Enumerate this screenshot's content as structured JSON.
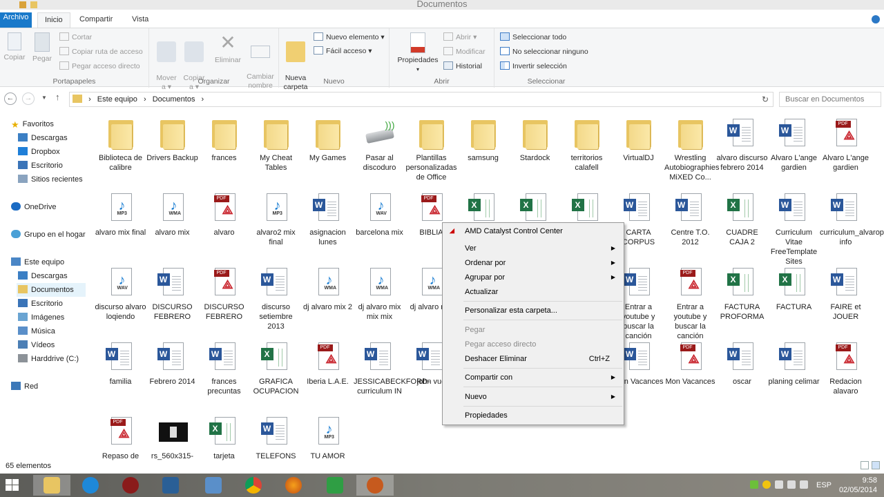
{
  "window": {
    "title": "Documentos"
  },
  "tabs": {
    "file": "Archivo",
    "home": "Inicio",
    "share": "Compartir",
    "view": "Vista"
  },
  "ribbon": {
    "clipboard": {
      "label": "Portapapeles",
      "copy": "Copiar",
      "paste": "Pegar",
      "cut": "Cortar",
      "copy_path": "Copiar ruta de acceso",
      "paste_shortcut": "Pegar acceso directo"
    },
    "organize": {
      "label": "Organizar",
      "move": "Mover\na ▾",
      "copy_to": "Copiar\na ▾",
      "delete": "Eliminar",
      "rename": "Cambiar\nnombre"
    },
    "new": {
      "label": "Nuevo",
      "new_folder": "Nueva\ncarpeta",
      "new_item": "Nuevo elemento ▾",
      "easy_access": "Fácil acceso ▾"
    },
    "open": {
      "label": "Abrir",
      "properties": "Propiedades",
      "open": "Abrir ▾",
      "edit": "Modificar",
      "history": "Historial"
    },
    "select": {
      "label": "Seleccionar",
      "select_all": "Seleccionar todo",
      "select_none": "No seleccionar ninguno",
      "invert": "Invertir selección"
    }
  },
  "address": {
    "crumbs": [
      "Este equipo",
      "›",
      "Documentos",
      "›"
    ],
    "search_placeholder": "Buscar en Documentos"
  },
  "navpane": {
    "favorites": "Favoritos",
    "downloads": "Descargas",
    "dropbox": "Dropbox",
    "desktop": "Escritorio",
    "recent": "Sitios recientes",
    "onedrive": "OneDrive",
    "homegroup": "Grupo en el hogar",
    "thispc": "Este equipo",
    "pc_downloads": "Descargas",
    "pc_documents": "Documentos",
    "pc_desktop": "Escritorio",
    "pc_images": "Imágenes",
    "pc_music": "Música",
    "pc_videos": "Vídeos",
    "pc_drive": "Harddrive (C:)",
    "network": "Red"
  },
  "files": [
    {
      "name": "Biblioteca de calibre",
      "type": "folder"
    },
    {
      "name": "Drivers Backup",
      "type": "folder"
    },
    {
      "name": "frances",
      "type": "folder"
    },
    {
      "name": "My Cheat Tables",
      "type": "folder"
    },
    {
      "name": "My Games",
      "type": "folder"
    },
    {
      "name": "Pasar al discoduro",
      "type": "drive"
    },
    {
      "name": "Plantillas personalizadas de Office",
      "type": "folder"
    },
    {
      "name": "samsung",
      "type": "folder"
    },
    {
      "name": "Stardock",
      "type": "folder"
    },
    {
      "name": "territorios calafell",
      "type": "folder"
    },
    {
      "name": "VirtualDJ",
      "type": "folder"
    },
    {
      "name": "Wrestling Autobiographies MiXED Co...",
      "type": "folder"
    },
    {
      "name": "alvaro discurso febrero 2014",
      "type": "word"
    },
    {
      "name": "Alvaro L'ange gardien",
      "type": "word"
    },
    {
      "name": "Alvaro L'ange gardien",
      "type": "pdf"
    },
    {
      "name": "alvaro mix final",
      "type": "mp3"
    },
    {
      "name": "alvaro mix",
      "type": "wma"
    },
    {
      "name": "alvaro",
      "type": "pdf"
    },
    {
      "name": "alvaro2 mix final",
      "type": "mp3"
    },
    {
      "name": "asignacion lunes",
      "type": "word"
    },
    {
      "name": "barcelona mix",
      "type": "wav"
    },
    {
      "name": "BIBLIA",
      "type": "pdf"
    },
    {
      "name": "",
      "type": "excel"
    },
    {
      "name": "",
      "type": "excel"
    },
    {
      "name": "",
      "type": "excel"
    },
    {
      "name": "CARTA CORPUS",
      "type": "word"
    },
    {
      "name": "Centre T.O. 2012",
      "type": "word"
    },
    {
      "name": "CUADRE CAJA 2",
      "type": "excel"
    },
    {
      "name": "Curriculum Vitae FreeTemplate Sites",
      "type": "word"
    },
    {
      "name": "curriculum_alvaropaez_B-info",
      "type": "word"
    },
    {
      "name": "discurso alvaro loqiendo",
      "type": "wav"
    },
    {
      "name": "DISCURSO FEBRERO",
      "type": "word"
    },
    {
      "name": "DISCURSO FEBRERO",
      "type": "pdf"
    },
    {
      "name": "discurso setiembre 2013",
      "type": "word"
    },
    {
      "name": "dj alvaro mix 2",
      "type": "wma"
    },
    {
      "name": "dj alvaro mix mix mix",
      "type": "wma"
    },
    {
      "name": "dj alvaro mix",
      "type": "wma"
    },
    {
      "name": "",
      "type": "none"
    },
    {
      "name": "",
      "type": "none"
    },
    {
      "name": "",
      "type": "none"
    },
    {
      "name": "Entrar a youtube y buscar la canción",
      "type": "word"
    },
    {
      "name": "Entrar a youtube y buscar la canción",
      "type": "pdf"
    },
    {
      "name": "FACTURA PROFORMA",
      "type": "excel"
    },
    {
      "name": "FACTURA",
      "type": "excel"
    },
    {
      "name": "FAIRE et JOUER",
      "type": "word"
    },
    {
      "name": "familia",
      "type": "word"
    },
    {
      "name": "Febrero 2014",
      "type": "word"
    },
    {
      "name": "frances precuntas",
      "type": "word"
    },
    {
      "name": "GRAFICA OCUPACION",
      "type": "excel"
    },
    {
      "name": "Iberia L.A.E.",
      "type": "pdf"
    },
    {
      "name": "JESSICABECKFORD-curriculum IN",
      "type": "word"
    },
    {
      "name": "john vue",
      "type": "word"
    },
    {
      "name": "",
      "type": "none"
    },
    {
      "name": "",
      "type": "none"
    },
    {
      "name": "",
      "type": "none"
    },
    {
      "name": "Mon Vacances",
      "type": "word"
    },
    {
      "name": "Mon Vacances",
      "type": "pdf"
    },
    {
      "name": "oscar",
      "type": "word"
    },
    {
      "name": "planing celimar",
      "type": "word"
    },
    {
      "name": "Redacion alavaro",
      "type": "pdf"
    },
    {
      "name": "Repaso de",
      "type": "pdf"
    },
    {
      "name": "rs_560x315-",
      "type": "image"
    },
    {
      "name": "tarjeta",
      "type": "excel"
    },
    {
      "name": "TELEFONS",
      "type": "word"
    },
    {
      "name": "TU AMOR",
      "type": "mp3"
    }
  ],
  "context_menu": {
    "amd": "AMD Catalyst Control Center",
    "view": "Ver",
    "sort": "Ordenar por",
    "group": "Agrupar por",
    "refresh": "Actualizar",
    "customize": "Personalizar esta carpeta...",
    "paste": "Pegar",
    "paste_shortcut": "Pegar acceso directo",
    "undo": "Deshacer Eliminar",
    "undo_shortcut": "Ctrl+Z",
    "share": "Compartir con",
    "new": "Nuevo",
    "properties": "Propiedades"
  },
  "status": {
    "count": "65 elementos"
  },
  "taskbar": {
    "lang": "ESP",
    "time": "9:58",
    "date": "02/05/2014"
  }
}
